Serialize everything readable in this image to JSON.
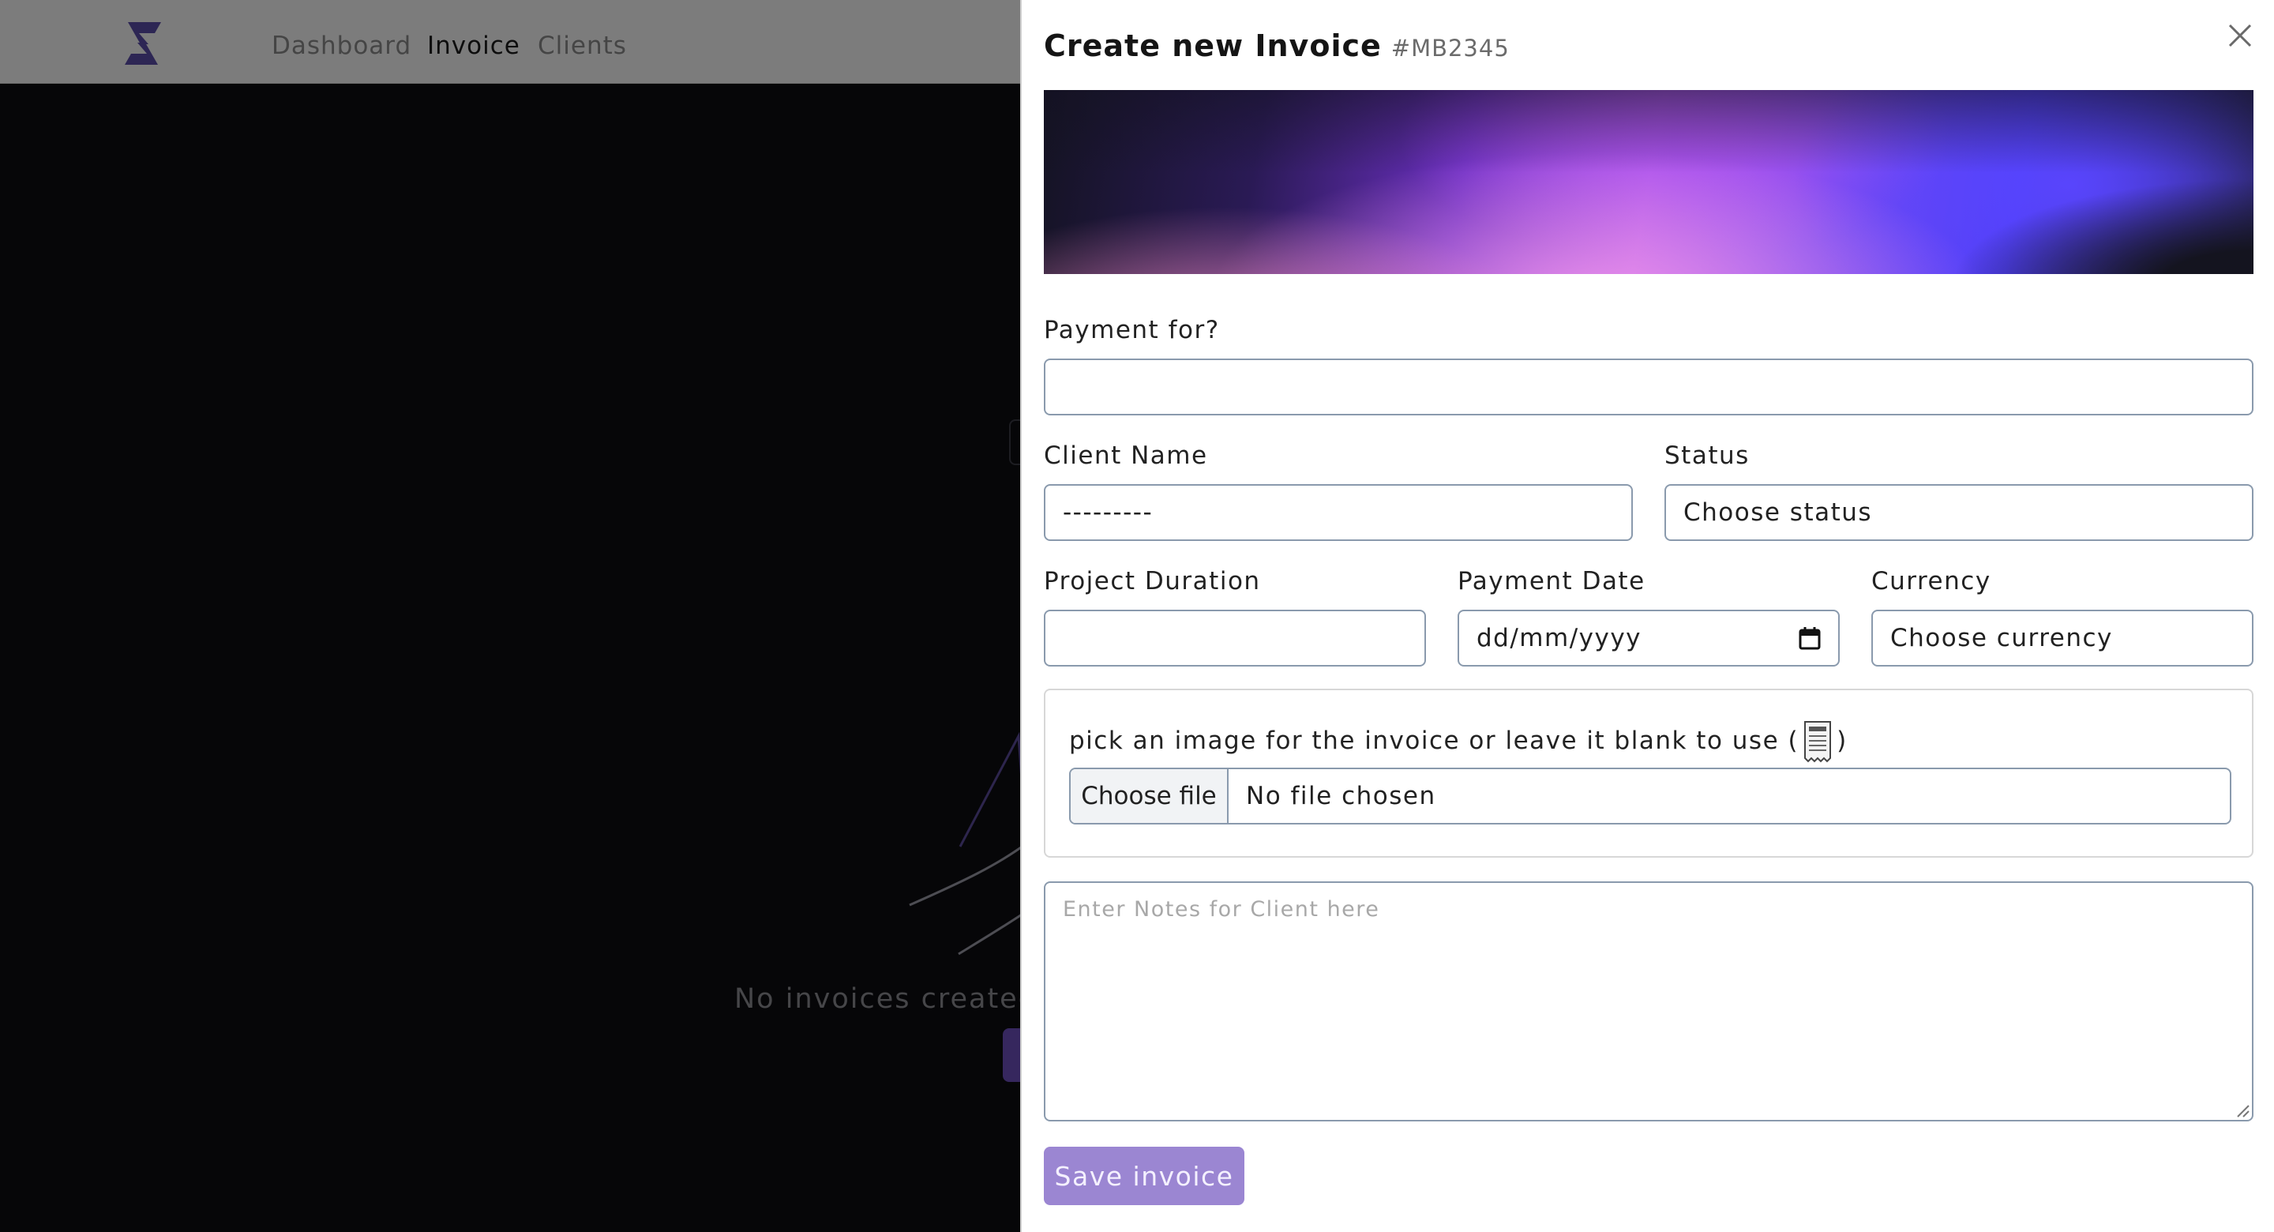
{
  "nav": {
    "links": [
      "Dashboard",
      "Invoice",
      "Clients"
    ]
  },
  "background": {
    "empty_text": "No invoices created"
  },
  "panel": {
    "title": "Create new Invoice",
    "code": "#MB2345",
    "fields": {
      "payment_for": {
        "label": "Payment for?",
        "value": ""
      },
      "client_name": {
        "label": "Client Name",
        "value": "---------"
      },
      "status": {
        "label": "Status",
        "value": "Choose status"
      },
      "project_duration": {
        "label": "Project Duration",
        "value": ""
      },
      "payment_date": {
        "label": "Payment Date",
        "placeholder": "dd/mm/yyyy"
      },
      "currency": {
        "label": "Currency",
        "value": "Choose currency"
      }
    },
    "image_picker": {
      "label_before": "pick an image for the invoice or leave it blank to use (",
      "label_after": ")",
      "button": "Choose file",
      "file_name": "No file chosen"
    },
    "notes": {
      "placeholder": "Enter Notes for Client here"
    },
    "save_button": "Save invoice"
  },
  "colors": {
    "accent": "#9b86d2",
    "logo": "#5b4ca8",
    "field_border": "#8a9aad"
  }
}
